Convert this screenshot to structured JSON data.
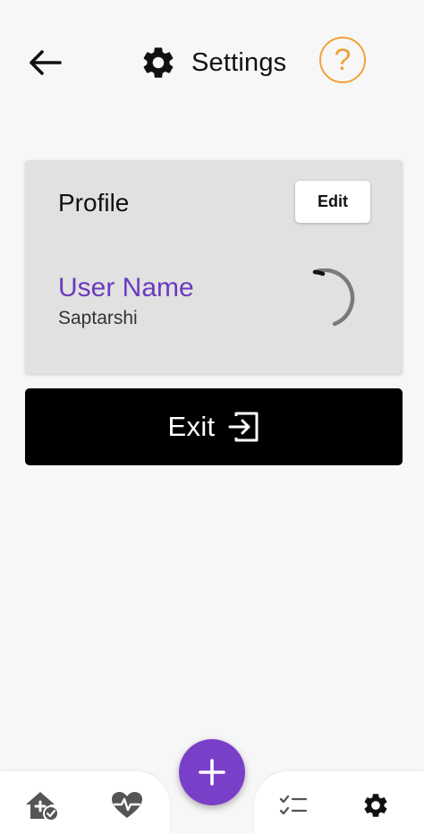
{
  "header": {
    "title": "Settings",
    "back_icon": "arrow-left-icon",
    "title_icon": "gear-icon",
    "help_icon": "question-mark-icon",
    "help_glyph": "?",
    "accent_color": "#f0a23a"
  },
  "profile": {
    "title": "Profile",
    "edit_label": "Edit",
    "user_label": "User Name",
    "user_value": "Saptarshi",
    "user_label_color": "#6a3bbf",
    "loading_icon": "spinner-icon"
  },
  "exit": {
    "label": "Exit",
    "icon": "exit-icon"
  },
  "bottom_nav": {
    "items": [
      {
        "icon": "home-check-icon"
      },
      {
        "icon": "heart-pulse-icon"
      },
      {
        "icon": "checklist-icon"
      },
      {
        "icon": "gear-icon",
        "active": true
      }
    ],
    "fab_icon": "plus-icon",
    "fab_color": "#7a3fc9"
  }
}
